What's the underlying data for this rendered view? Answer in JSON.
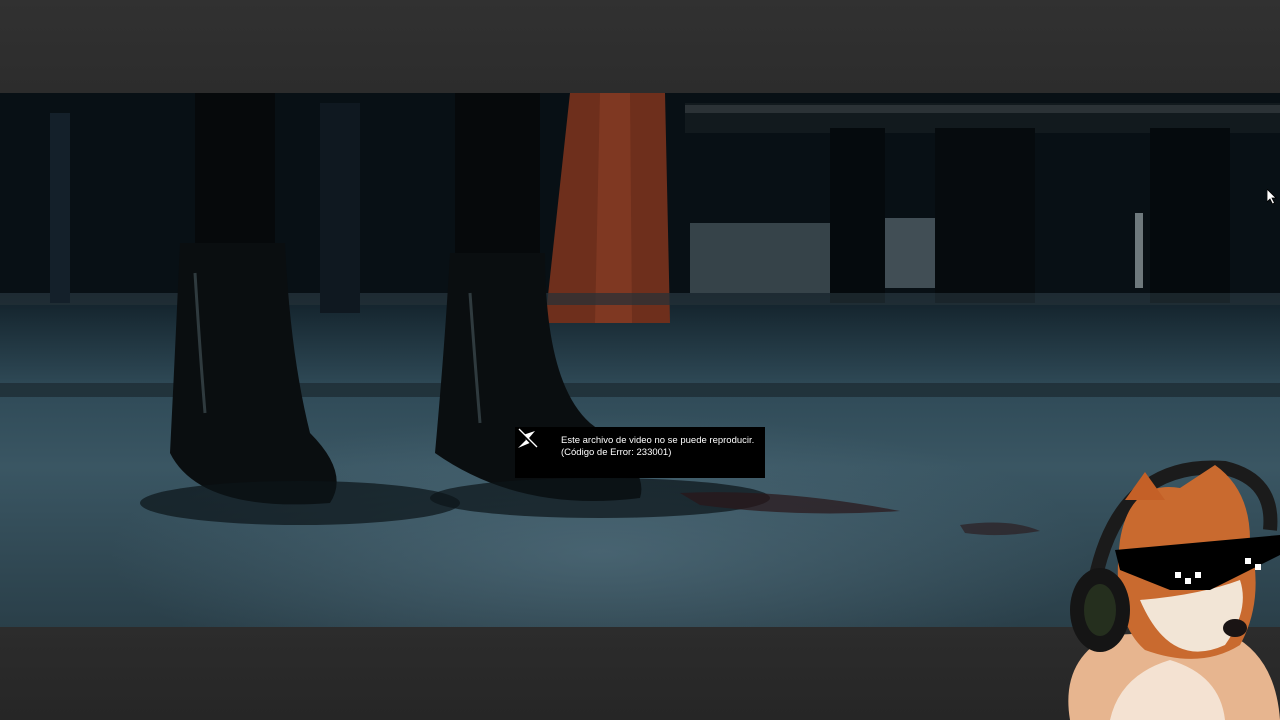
{
  "player": {
    "error": {
      "line1": "Este archivo de video no se puede reproducir.",
      "line2": "(Código de Error: 233001)",
      "icon": "broken-video-icon"
    }
  },
  "colors": {
    "letterbox": "#2b2b2b",
    "error_background": "#000000",
    "error_text": "#ffffff"
  }
}
